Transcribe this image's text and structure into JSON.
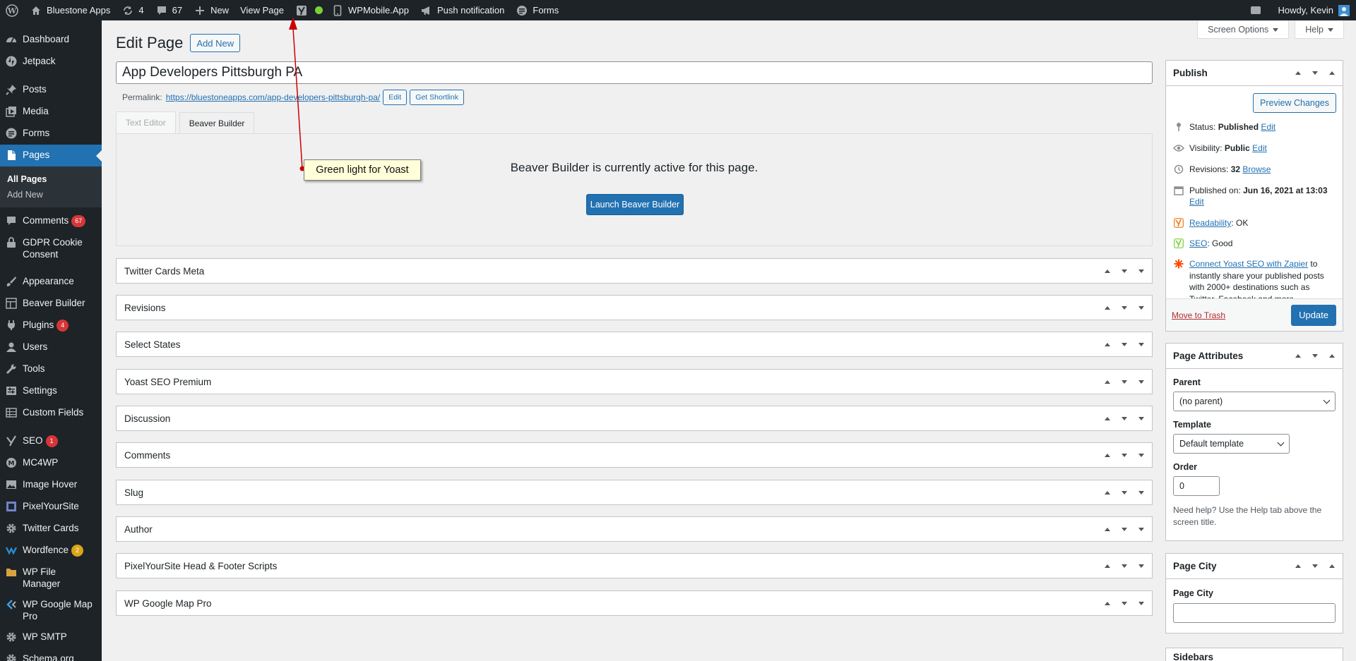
{
  "adminbar": {
    "site_name": "Bluestone Apps",
    "updates_count": "4",
    "comments_count": "67",
    "new_label": "New",
    "view_page_label": "View Page",
    "wpmobile_label": "WPMobile.App",
    "push_label": "Push notification",
    "forms_label": "Forms",
    "howdy": "Howdy, Kevin"
  },
  "sidebar": {
    "dashboard": "Dashboard",
    "jetpack": "Jetpack",
    "posts": "Posts",
    "media": "Media",
    "forms": "Forms",
    "pages": "Pages",
    "all_pages": "All Pages",
    "add_new": "Add New",
    "comments": "Comments",
    "comments_badge": "67",
    "gdpr": "GDPR Cookie Consent",
    "appearance": "Appearance",
    "beaver_builder": "Beaver Builder",
    "plugins": "Plugins",
    "plugins_badge": "4",
    "users": "Users",
    "tools": "Tools",
    "settings": "Settings",
    "custom_fields": "Custom Fields",
    "seo": "SEO",
    "seo_badge": "1",
    "mc4wp": "MC4WP",
    "image_hover": "Image Hover",
    "pixelyoursite": "PixelYourSite",
    "twitter_cards": "Twitter Cards",
    "wordfence": "Wordfence",
    "wordfence_badge": "2",
    "wp_file_manager": "WP File Manager",
    "wp_google_map": "WP Google Map Pro",
    "wp_smtp": "WP SMTP",
    "schema": "Schema.org Settings"
  },
  "screen_meta": {
    "screen_options": "Screen Options",
    "help": "Help"
  },
  "header": {
    "title": "Edit Page",
    "add_new": "Add New"
  },
  "post": {
    "title": "App Developers Pittsburgh PA",
    "permalink_label": "Permalink:",
    "permalink_url": "https://bluestoneapps.com/app-developers-pittsburgh-pa/",
    "edit_btn": "Edit",
    "shortlink_btn": "Get Shortlink"
  },
  "editor": {
    "tab_text": "Text Editor",
    "tab_bb": "Beaver Builder",
    "bb_message": "Beaver Builder is currently active for this page.",
    "bb_launch": "Launch Beaver Builder"
  },
  "metaboxes": [
    "Twitter Cards Meta",
    "Revisions",
    "Select States",
    "Yoast SEO Premium",
    "Discussion",
    "Comments",
    "Slug",
    "Author",
    "PixelYourSite Head & Footer Scripts",
    "WP Google Map Pro"
  ],
  "publish": {
    "title": "Publish",
    "preview": "Preview Changes",
    "status_label": "Status:",
    "status_value": "Published",
    "visibility_label": "Visibility:",
    "visibility_value": "Public",
    "revisions_label": "Revisions:",
    "revisions_value": "32",
    "browse": "Browse",
    "published_label": "Published on:",
    "published_value": "Jun 16, 2021 at 13:03",
    "edit": "Edit",
    "readability_link": "Readability",
    "readability_value": ": OK",
    "seo_link": "SEO",
    "seo_value": ": Good",
    "zapier_link": "Connect Yoast SEO with Zapier",
    "zapier_text": " to instantly share your published posts with 2000+ destinations such as Twitter, Facebook and more.",
    "trash": "Move to Trash",
    "update": "Update"
  },
  "attributes": {
    "title": "Page Attributes",
    "parent_label": "Parent",
    "parent_value": "(no parent)",
    "template_label": "Template",
    "template_value": "Default template",
    "order_label": "Order",
    "order_value": "0",
    "help_text": "Need help? Use the Help tab above the screen title."
  },
  "page_city": {
    "title": "Page City",
    "field_label": "Page City"
  },
  "sidebars_box": {
    "title": "Sidebars"
  },
  "annotation": {
    "callout": "Green light for Yoast"
  },
  "colors": {
    "accent": "#2271b1",
    "adminbar": "#1d2327",
    "badge_red": "#d63638",
    "yoast_green": "#7ad03a",
    "annotation_red": "#cc0000"
  }
}
